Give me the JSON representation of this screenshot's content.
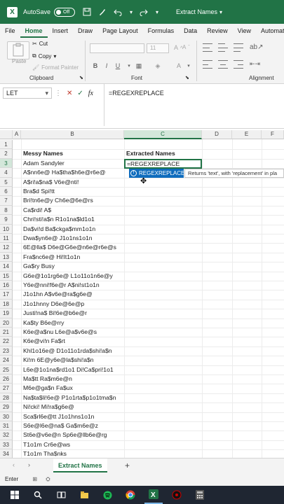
{
  "titlebar": {
    "logo": "X",
    "autosave_label": "AutoSave",
    "autosave_state": "Off",
    "icons": [
      "save-icon",
      "paintbrush-icon",
      "undo-icon",
      "redo-icon",
      "customize-icon"
    ],
    "document_title": "Extract Names",
    "color": "#217346"
  },
  "menu": {
    "tabs": [
      "File",
      "Home",
      "Insert",
      "Draw",
      "Page Layout",
      "Formulas",
      "Data",
      "Review",
      "View",
      "Automate"
    ],
    "active": "Home"
  },
  "ribbon": {
    "paste_label": "Paste",
    "cut_label": "Cut",
    "copy_label": "Copy",
    "format_painter_label": "Format Painter",
    "clipboard_group": "Clipboard",
    "font_group": "Font",
    "alignment_group": "Alignment",
    "font_size": "11",
    "bold": "B",
    "italic": "I",
    "underline": "U"
  },
  "formula_bar": {
    "name_box": "LET",
    "cancel": "✕",
    "enter": "✓",
    "fx": "fx",
    "formula": "=REGEXREPLACE"
  },
  "columns": [
    "A",
    "B",
    "C",
    "D",
    "E",
    "F"
  ],
  "rows": [
    "1",
    "2",
    "3",
    "4",
    "5",
    "6",
    "7",
    "8",
    "9",
    "10",
    "11",
    "12",
    "13",
    "14",
    "15",
    "16",
    "17",
    "18",
    "19",
    "20",
    "21",
    "22",
    "23",
    "24",
    "25",
    "26",
    "27",
    "28",
    "29",
    "30",
    "31",
    "32",
    "33",
    "34"
  ],
  "sheet": {
    "b_header": "Messy Names",
    "c_header": "Extracted Names",
    "active_cell_value": "=REGEXREPLACE",
    "names": [
      "Adam Sandyler",
      "A$nn6e@ Ha$tha$h6e@r6e@",
      "A$ri!a$na$ V6e@nti!",
      "Bra$d Spi!tt",
      "Bri!tn6e@y Ch6e@6e@rs",
      "Ca$rdi! A$",
      "Chri!sti!a$n R1o1na$ld1o1",
      "Da$vi!d Ba$ckga$mm1o1n",
      "Dwa$yn6e@ J1o1ns1o1n",
      "6E@lla$ D6e@G6e@n6e@r6e@s",
      "Fra$nc6e@ Hi!lt1o1n",
      "Ga$ry Busy",
      "G6e@1o1rg6e@ L1o11o1n6e@y",
      "Y6e@nni!f6e@r A$ni!st1o1n",
      "J1o1hn A$v6e@ra$g6e@",
      "J1o1hnny D6e@6e@p",
      "Justi!na$ Bi!6e@b6e@r",
      "Ka$ty B6e@rry",
      "K6e@a$nu L6e@a$v6e@s",
      "K6e@vi!n Fa$rt",
      "Khl1o16e@ D1o11o1rda$shi!a$n",
      "Ki!m 6E@y6e@la$shi!a$n",
      "L6e@1o1na$rd1o1 Di!Ca$pri!1o1",
      "Ma$tt Ra$m6e@n",
      "M6e@ga$n Fa$ux",
      "Na$ta$li!6e@ P1o1rta$p1o1tma$n",
      "Ni!cki! Mi!ra$g6e@",
      "Sca$rl6e@tt J1o1hns1o1n",
      "S6e@l6e@na$ Ga$m6e@z",
      "St6e@v6e@n Sp6e@llb6e@rg",
      "T1o1m Cr6e@ws",
      "T1o1m Tha$nks"
    ]
  },
  "autocomplete": {
    "item": "REGEXREPLACE",
    "description": "Returns 'text', with 'replacement' in pla"
  },
  "sheet_tabs": {
    "active": "Extract Names",
    "add": "+"
  },
  "status": {
    "mode": "Enter"
  },
  "taskbar": {
    "icons": [
      "windows-icon",
      "search-icon",
      "task-view-icon",
      "files-icon",
      "spotify-icon",
      "chrome-icon",
      "excel-icon",
      "recorder-icon",
      "calculator-icon"
    ]
  }
}
